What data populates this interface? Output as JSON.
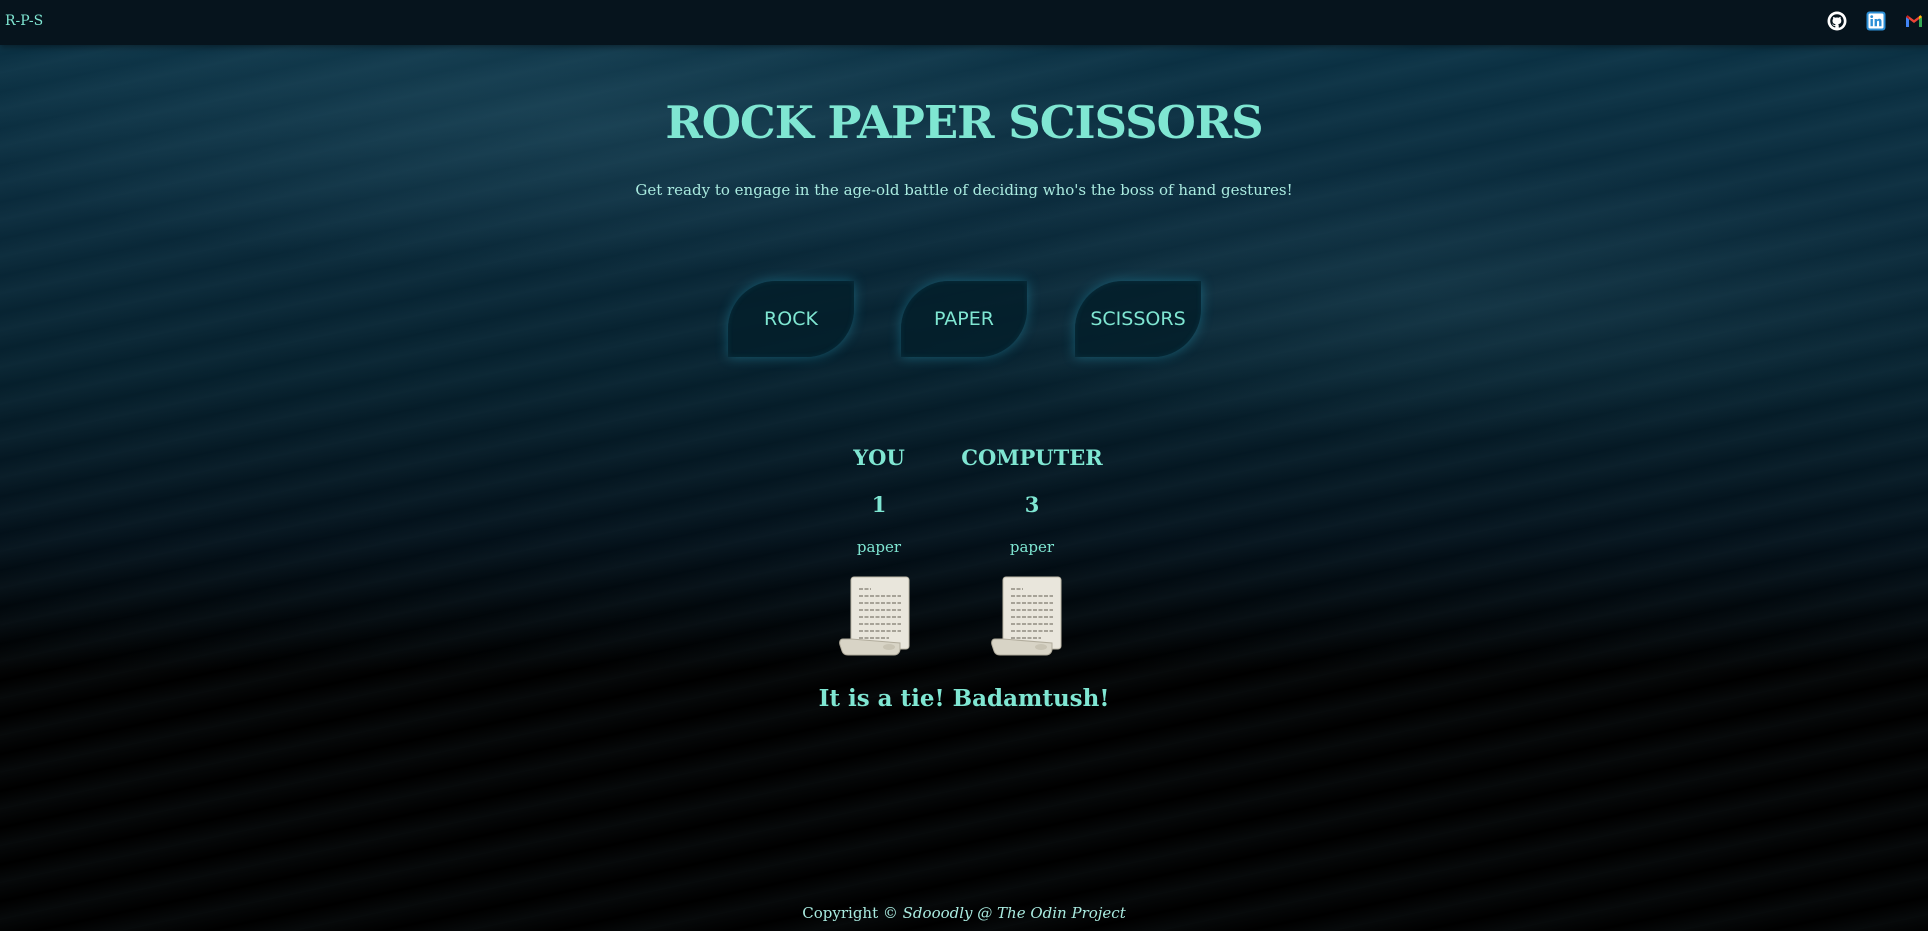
{
  "navbar": {
    "brand": "R-P-S",
    "links": [
      {
        "name": "github-icon"
      },
      {
        "name": "linkedin-icon"
      },
      {
        "name": "gmail-icon"
      }
    ]
  },
  "header": {
    "title": "ROCK PAPER SCISSORS",
    "subtitle": "Get ready to engage in the age-old battle of deciding who's the boss of hand gestures!"
  },
  "choices": {
    "rock": "ROCK",
    "paper": "PAPER",
    "scissors": "SCISSORS"
  },
  "scoreboard": {
    "player": {
      "name": "YOU",
      "score": "1",
      "choice": "paper",
      "icon": "scroll-icon"
    },
    "computer": {
      "name": "COMPUTER",
      "score": "3",
      "choice": "paper",
      "icon": "scroll-icon"
    }
  },
  "result": "It is a tie! Badamtush!",
  "footer": {
    "prefix": "Copyright © ",
    "credit": "Sdooodly @ The Odin Project"
  },
  "colors": {
    "accent": "#7fe6d2",
    "navbar": "#06141d",
    "background_top": "#0b3346",
    "background_bottom": "#000000"
  }
}
